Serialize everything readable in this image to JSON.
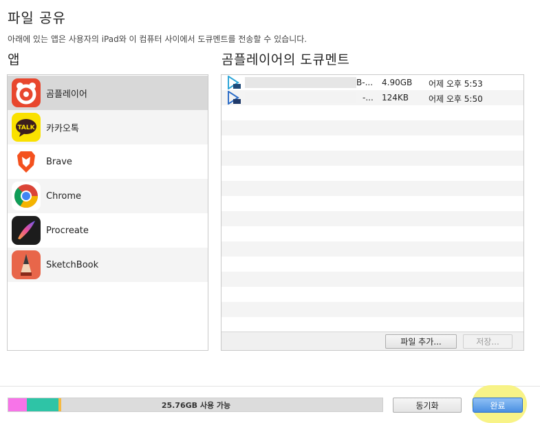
{
  "header": {
    "title": "파일 공유",
    "subtitle": "아래에 있는 앱은 사용자의 iPad와 이 컴퓨터 사이에서 도큐멘트를 전송할 수 있습니다."
  },
  "apps": {
    "heading": "앱",
    "items": [
      {
        "label": "곰플레이어",
        "icon": "gom-player-icon"
      },
      {
        "label": "카카오톡",
        "icon": "kakaotalk-icon"
      },
      {
        "label": "Brave",
        "icon": "brave-icon"
      },
      {
        "label": "Chrome",
        "icon": "chrome-icon"
      },
      {
        "label": "Procreate",
        "icon": "procreate-icon"
      },
      {
        "label": "SketchBook",
        "icon": "sketchbook-icon"
      }
    ],
    "kakao_badge": "TALK"
  },
  "documents": {
    "heading": "곰플레이어의 도큐멘트",
    "files": [
      {
        "name_tail": "B-...",
        "size": "4.90GB",
        "date": "어제 오후 5:53",
        "icon": "video-file-icon"
      },
      {
        "name_tail": "-...",
        "size": "124KB",
        "date": "어제 오후 5:50",
        "icon": "subtitle-file-icon"
      }
    ],
    "add_button": "파일 추가...",
    "save_button": "저장..."
  },
  "footer": {
    "storage_label": "25.76GB 사용 가능",
    "storage_segments_fraction": [
      {
        "kind": "media",
        "color": "#f774e8",
        "fraction": 0.049
      },
      {
        "kind": "apps",
        "color": "#2ec4a6",
        "fraction": 0.084
      },
      {
        "kind": "other",
        "color": "#f5b942",
        "fraction": 0.007
      }
    ],
    "sync_button": "동기화",
    "done_button": "완료"
  }
}
